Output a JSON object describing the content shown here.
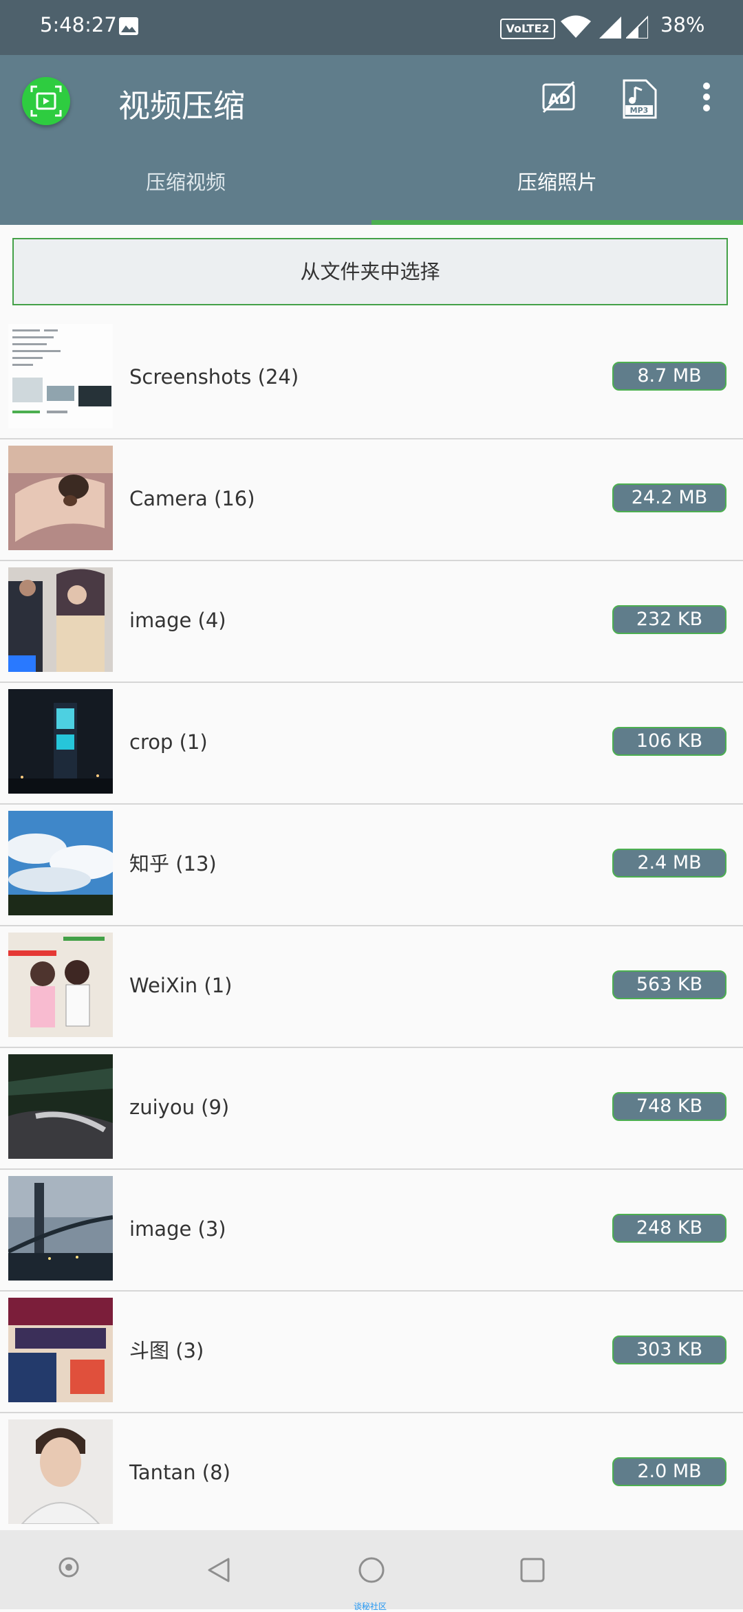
{
  "status_bar": {
    "time": "5:48:27",
    "volte": "VoLTE2",
    "battery": "38%"
  },
  "app_bar": {
    "title": "视频压缩",
    "icons": [
      "app-logo-icon",
      "no-ads-icon",
      "mp3-file-icon",
      "more-vert-icon"
    ],
    "mp3_label": "MP3"
  },
  "tabs": [
    {
      "label": "压缩视频",
      "selected": false
    },
    {
      "label": "压缩照片",
      "selected": true
    }
  ],
  "select_button": {
    "label": "从文件夹中选择"
  },
  "folders": [
    {
      "label": "Screenshots (24)",
      "size": "8.7 MB"
    },
    {
      "label": "Camera (16)",
      "size": "24.2 MB"
    },
    {
      "label": "image (4)",
      "size": "232 KB"
    },
    {
      "label": "crop (1)",
      "size": "106 KB"
    },
    {
      "label": "知乎 (13)",
      "size": "2.4 MB"
    },
    {
      "label": "WeiXin (1)",
      "size": "563 KB"
    },
    {
      "label": "zuiyou (9)",
      "size": "748 KB"
    },
    {
      "label": "image (3)",
      "size": "248 KB"
    },
    {
      "label": "斗图 (3)",
      "size": "303 KB"
    },
    {
      "label": "Tantan (8)",
      "size": "2.0 MB"
    }
  ],
  "nav_bar": {
    "icons": [
      "assistant-icon",
      "back-icon",
      "home-icon",
      "recents-icon"
    ],
    "watermark": "谈秘社区"
  },
  "colors": {
    "status_bar": "#4e616c",
    "app_bar": "#607d8b",
    "accent": "#4caf50",
    "badge": "#607d8b"
  }
}
